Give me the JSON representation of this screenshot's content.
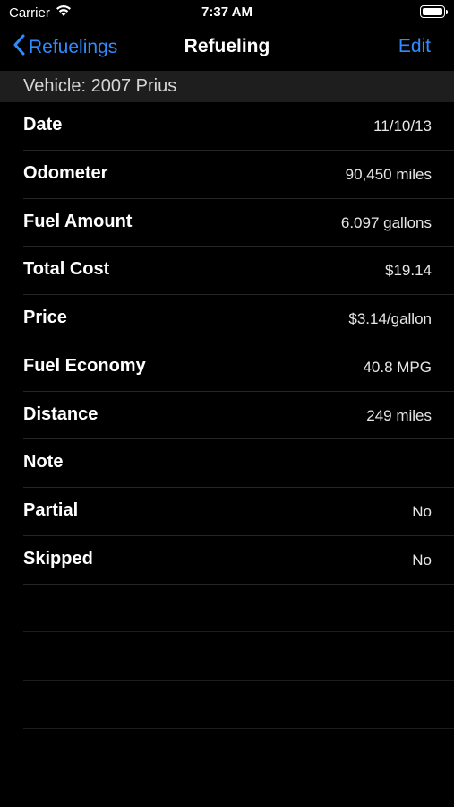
{
  "status": {
    "carrier": "Carrier",
    "time": "7:37 AM"
  },
  "nav": {
    "back_label": "Refuelings",
    "title": "Refueling",
    "edit_label": "Edit"
  },
  "section": {
    "header": "Vehicle: 2007 Prius"
  },
  "rows": [
    {
      "label": "Date",
      "value": "11/10/13"
    },
    {
      "label": "Odometer",
      "value": "90,450 miles"
    },
    {
      "label": "Fuel Amount",
      "value": "6.097 gallons"
    },
    {
      "label": "Total Cost",
      "value": "$19.14"
    },
    {
      "label": "Price",
      "value": "$3.14/gallon"
    },
    {
      "label": "Fuel Economy",
      "value": "40.8 MPG"
    },
    {
      "label": "Distance",
      "value": "249 miles"
    },
    {
      "label": "Note",
      "value": ""
    },
    {
      "label": "Partial",
      "value": "No"
    },
    {
      "label": "Skipped",
      "value": "No"
    }
  ],
  "colors": {
    "accent": "#2f8bff",
    "background": "#000000",
    "section_header_bg": "#1e1e1e"
  },
  "icons": {
    "wifi": "wifi-icon",
    "battery": "battery-icon",
    "back": "chevron-left-icon"
  }
}
